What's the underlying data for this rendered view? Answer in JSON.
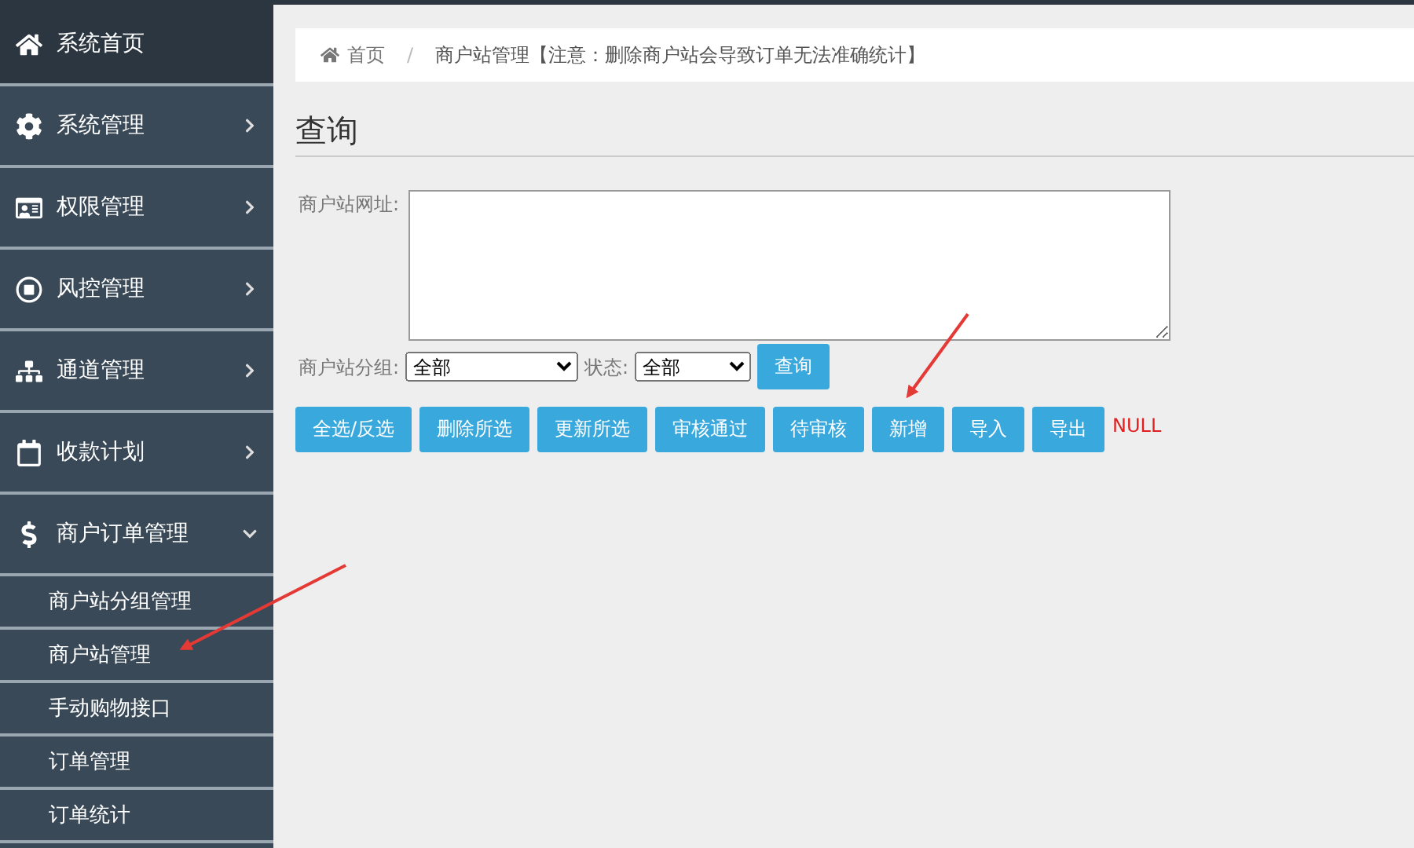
{
  "sidebar": {
    "items": [
      {
        "label": "系统首页"
      },
      {
        "label": "系统管理",
        "expanded": false
      },
      {
        "label": "权限管理",
        "expanded": false
      },
      {
        "label": "风控管理",
        "expanded": false
      },
      {
        "label": "通道管理",
        "expanded": false
      },
      {
        "label": "收款计划",
        "expanded": false
      },
      {
        "label": "商户订单管理",
        "expanded": true,
        "children": [
          {
            "label": "商户站分组管理"
          },
          {
            "label": "商户站管理"
          },
          {
            "label": "手动购物接口"
          },
          {
            "label": "订单管理"
          },
          {
            "label": "订单统计"
          }
        ]
      }
    ]
  },
  "breadcrumb": {
    "home": "首页",
    "separator": "/",
    "current": "商户站管理",
    "note": "【注意：删除商户站会导致订单无法准确统计】"
  },
  "section_title": "查询",
  "form": {
    "url_label": "商户站网址:",
    "group_label": "商户站分组:",
    "group_value": "全部",
    "status_label": "状态:",
    "status_value": "全部",
    "query_button": "查询"
  },
  "actions": [
    "全选/反选",
    "删除所选",
    "更新所选",
    "审核通过",
    "待审核",
    "新增",
    "导入",
    "导出"
  ],
  "result": "NULL"
}
